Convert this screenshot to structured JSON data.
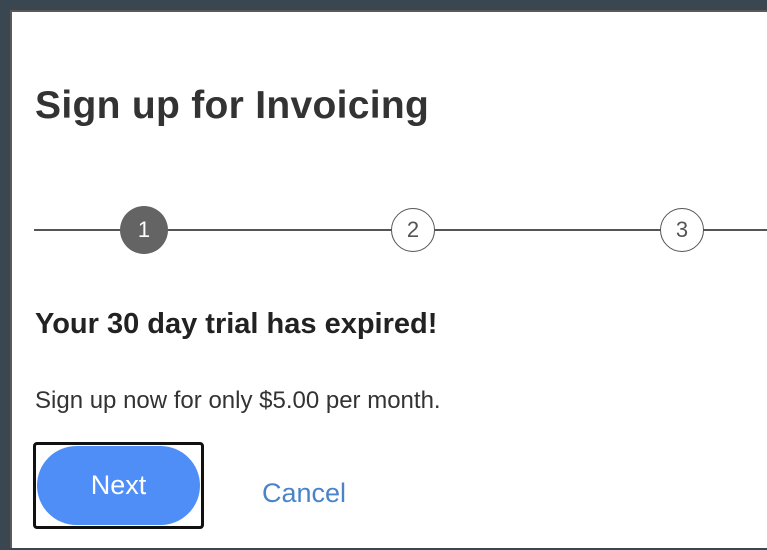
{
  "dialog": {
    "title": "Sign up for Invoicing",
    "steps": [
      {
        "label": "1",
        "state": "active"
      },
      {
        "label": "2",
        "state": "inactive"
      },
      {
        "label": "3",
        "state": "inactive"
      }
    ],
    "heading": "Your 30 day trial has expired!",
    "message": "Sign up now for only $5.00 per month.",
    "next_label": "Next",
    "cancel_label": "Cancel"
  },
  "colors": {
    "primary_button": "#4f8ef7",
    "link": "#4a83c9",
    "active_step": "#646464"
  }
}
